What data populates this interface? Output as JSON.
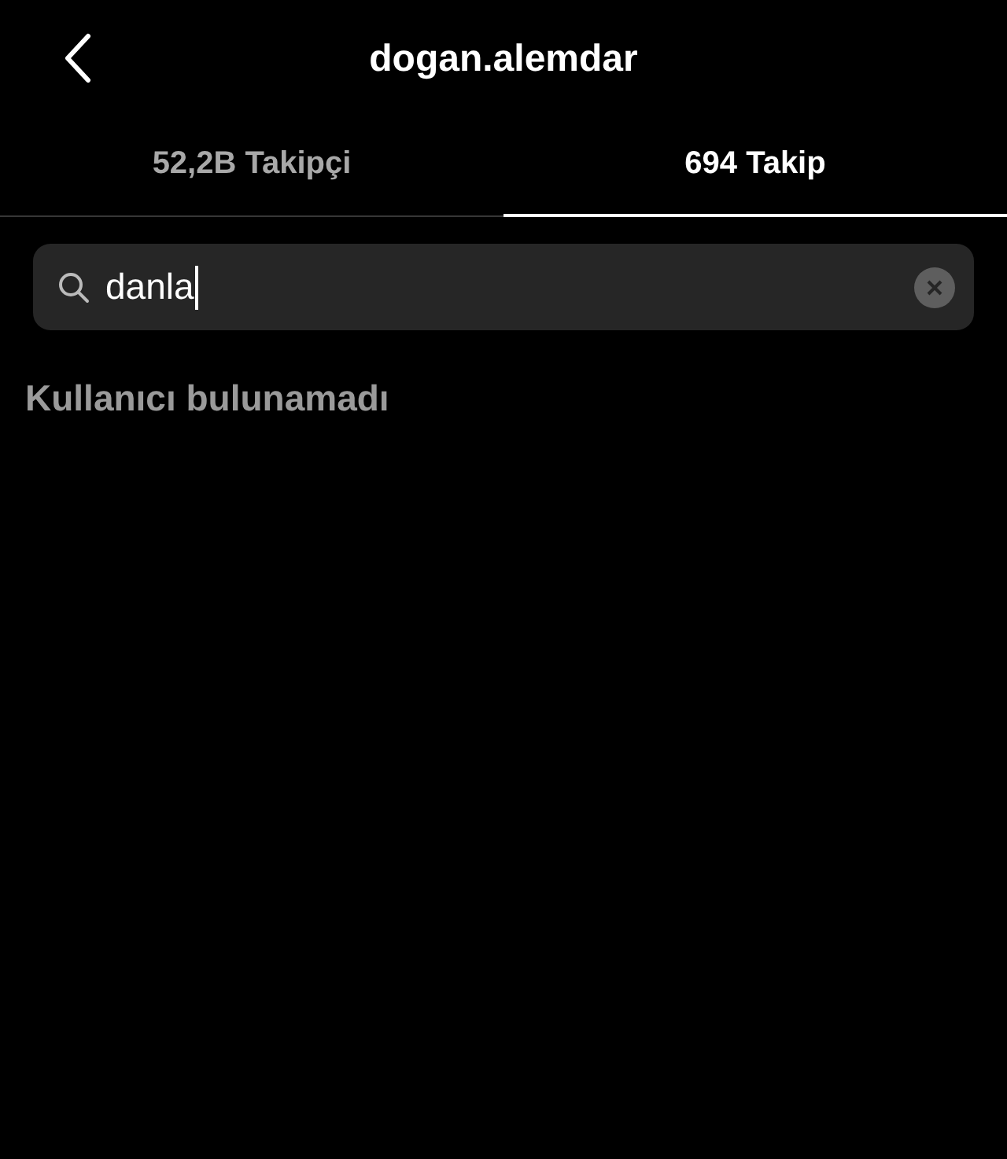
{
  "header": {
    "title": "dogan.alemdar"
  },
  "tabs": [
    {
      "label": "52,2B Takipçi",
      "selected": false
    },
    {
      "label": "694 Takip",
      "selected": true
    }
  ],
  "search": {
    "value": "danla"
  },
  "message": "Kullanıcı bulunamadı"
}
